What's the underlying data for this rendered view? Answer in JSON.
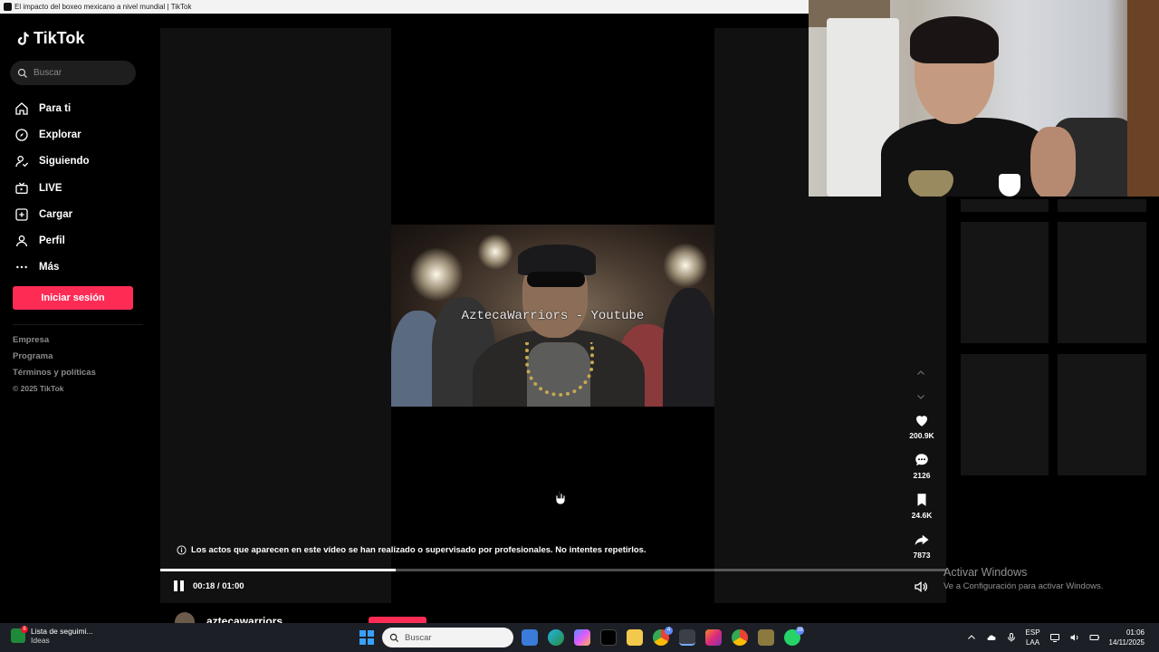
{
  "window": {
    "title": "El impacto del boxeo mexicano a nivel mundial | TikTok"
  },
  "sidebar": {
    "logo": "TikTok",
    "search_placeholder": "Buscar",
    "nav": [
      {
        "label": "Para ti",
        "icon": "home-icon"
      },
      {
        "label": "Explorar",
        "icon": "compass-icon"
      },
      {
        "label": "Siguiendo",
        "icon": "following-icon"
      },
      {
        "label": "LIVE",
        "icon": "live-tv-icon"
      },
      {
        "label": "Cargar",
        "icon": "upload-plus-icon"
      },
      {
        "label": "Perfil",
        "icon": "profile-icon"
      },
      {
        "label": "Más",
        "icon": "more-dots-icon"
      }
    ],
    "login_label": "Iniciar sesión",
    "footer": {
      "empresa": "Empresa",
      "programa": "Programa",
      "terminos": "Términos y políticas",
      "copyright": "© 2025 TikTok"
    }
  },
  "video": {
    "watermark": "AztecaWarriors - Youtube",
    "disclaimer": "Los actos que aparecen en este vídeo se han realizado o supervisado por profesionales. No intentes repetirlos.",
    "time": "00:18 / 01:00",
    "progress_fraction": 0.3,
    "author": "aztecawarriors"
  },
  "actions": {
    "likes": "200.9K",
    "comments": "2126",
    "saves": "24.6K",
    "shares": "7873"
  },
  "watermark_windows": {
    "line1": "Activar Windows",
    "line2": "Ve a Configuración para activar Windows."
  },
  "taskbar": {
    "widget_title": "Lista de seguimi...",
    "widget_sub": "Ideas",
    "widget_badge": "8",
    "search_placeholder": "Buscar",
    "notif_badge_1": "4",
    "notif_badge_2": "38",
    "lang_top": "ESP",
    "lang_bottom": "LAA",
    "time": "01:06",
    "date": "14/11/2025"
  },
  "colors": {
    "accent": "#fe2c55",
    "background": "#000000",
    "panel": "#111111"
  }
}
